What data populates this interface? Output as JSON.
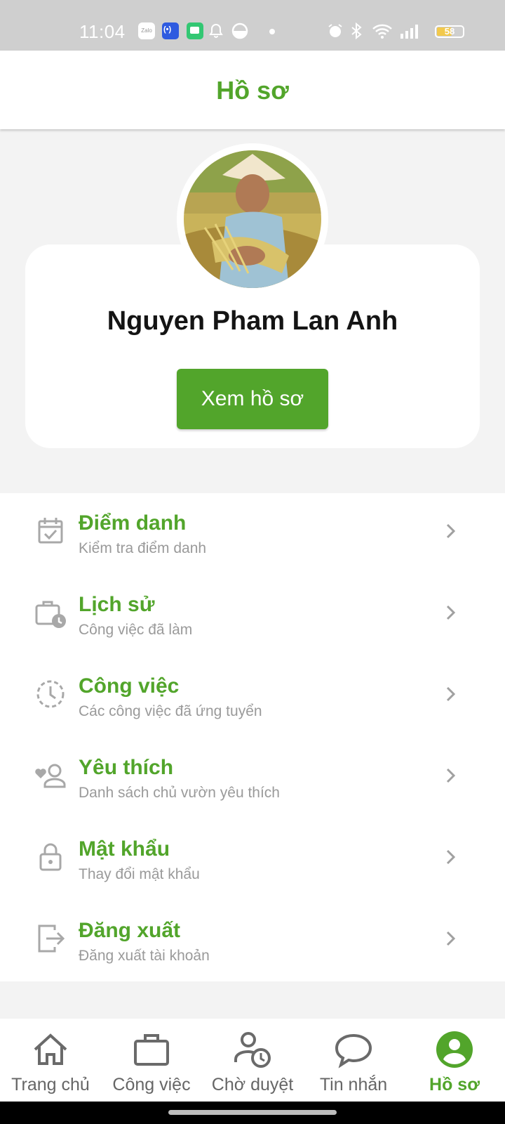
{
  "status_bar": {
    "time": "11:04",
    "zalo_label": "Zalo",
    "battery": "58",
    "battery_level": 0.58,
    "icons": [
      "zalo-icon",
      "radio-icon",
      "chat-icon",
      "bell-icon",
      "half-moon-icon",
      "alarm-icon",
      "bluetooth-icon",
      "wifi-icon",
      "signal-icon",
      "battery-icon"
    ]
  },
  "header": {
    "title": "Hồ sơ"
  },
  "profile": {
    "name": "Nguyen Pham Lan Anh",
    "view_button": "Xem hồ sơ"
  },
  "menu": {
    "items": [
      {
        "title": "Điểm danh",
        "subtitle": "Kiểm tra điểm danh",
        "icon": "calendar-check-icon"
      },
      {
        "title": "Lịch sử",
        "subtitle": "Công việc đã làm",
        "icon": "briefcase-clock-icon"
      },
      {
        "title": "Công việc",
        "subtitle": "Các công việc đã ứng tuyển",
        "icon": "clock-dashed-icon"
      },
      {
        "title": "Yêu thích",
        "subtitle": "Danh sách chủ vườn yêu thích",
        "icon": "heart-user-icon"
      },
      {
        "title": "Mật khẩu",
        "subtitle": "Thay đổi mật khẩu",
        "icon": "lock-icon"
      },
      {
        "title": "Đăng xuất",
        "subtitle": "Đăng xuất tài khoản",
        "icon": "logout-icon"
      }
    ]
  },
  "bottom_nav": {
    "items": [
      {
        "label": "Trang chủ",
        "icon": "home-icon"
      },
      {
        "label": "Công việc",
        "icon": "briefcase-icon"
      },
      {
        "label": "Chờ duyệt",
        "icon": "user-clock-icon"
      },
      {
        "label": "Tin nhắn",
        "icon": "chat-bubble-icon"
      },
      {
        "label": "Hồ sơ",
        "icon": "account-circle-icon"
      }
    ],
    "active_index": 4
  },
  "colors": {
    "accent": "#52a52b",
    "status_bar": "#cfcfcf",
    "background": "#f3f3f3",
    "subtitle": "#9a9a9a",
    "icon_gray": "#a8a8a8",
    "nav_gray": "#666666"
  }
}
